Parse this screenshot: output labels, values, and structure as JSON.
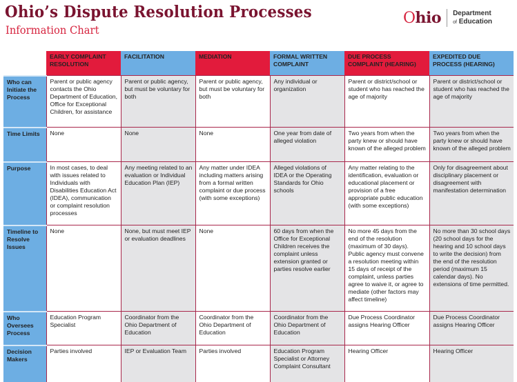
{
  "header": {
    "title": "Ohio’s Dispute Resolution Processes",
    "subtitle": "Information Chart",
    "logo": {
      "brand": "Ohio",
      "brand_first": "O",
      "brand_rest": "hio",
      "dept_line1": "Department",
      "dept_of": "of",
      "dept_line2": "Education"
    }
  },
  "colors": {
    "title": "#7a1430",
    "subtitle": "#d6243f",
    "red_header": "#e21b3c",
    "blue_header": "#6daee3",
    "gray_cell": "#e4e4e6",
    "grid_line": "#a8264a"
  },
  "table": {
    "columns": [
      {
        "label": "EARLY COMPLAINT RESOLUTION",
        "color": "red",
        "shade": "white"
      },
      {
        "label": "FACILITATION",
        "color": "blue",
        "shade": "gray"
      },
      {
        "label": "MEDIATION",
        "color": "red",
        "shade": "white"
      },
      {
        "label": "FORMAL WRITTEN COMPLAINT",
        "color": "blue",
        "shade": "gray"
      },
      {
        "label": "DUE PROCESS COMPLAINT (HEARING)",
        "color": "red",
        "shade": "white"
      },
      {
        "label": "EXPEDITED DUE PROCESS (HEARING)",
        "color": "blue",
        "shade": "gray"
      }
    ],
    "rows": [
      {
        "label": "Who can Initiate the Process",
        "cells": [
          "Parent or public agency contacts the Ohio Department of Education, Office for Exceptional Children, for assistance",
          "Parent or public agency, but must be voluntary for both",
          "Parent or public agency, but must be voluntary for both",
          "Any individual or organization",
          "Parent or district/school or student who has reached the age of majority",
          "Parent or district/school or student who has reached the age of majority"
        ]
      },
      {
        "label": "Time Limits",
        "cells": [
          "None",
          "None",
          "None",
          "One year from date of alleged violation",
          "Two years from when the party knew or should have known of the alleged problem",
          "Two years from when the party knew or should have known of the alleged problem"
        ]
      },
      {
        "label": "Purpose",
        "cells": [
          "In most cases, to deal with issues related to Individuals with Disabilities Education Act (IDEA), communication or complaint resolution processes",
          "Any meeting related to an evaluation or Individual Education Plan (IEP)",
          "Any matter under IDEA including matters arising from a formal written complaint or due process (with some exceptions)",
          "Alleged violations of IDEA or the Operating Standards for Ohio schools",
          "Any matter relating to the identification, evaluation or educational placement or provision of a free appropriate public education (with some exceptions)",
          "Only for disagreement about disciplinary placement or disagreement with manifestation determination"
        ]
      },
      {
        "label": "Timeline to Resolve Issues",
        "cells": [
          "None",
          "None, but must meet IEP or evaluation deadlines",
          "None",
          "60 days from when the Office for Exceptional Children receives the complaint unless extension granted or parties resolve earlier",
          "No more 45 days from the end of the resolution (maximum of 30 days). Public agency must convene a resolution meeting within 15 days of receipt of the complaint, unless parties agree to waive it, or agree to mediate (other factors may affect timeline)",
          "No more than 30 school days (20 school days for the hearing and 10 school days to write the decision) from the end of the resolution period (maximum 15 calendar days). No extensions of time permitted."
        ]
      },
      {
        "label": "Who Oversees Process",
        "cells": [
          "Education Program Specialist",
          "Coordinator from the Ohio Department of Education",
          "Coordinator from the Ohio Department of Education",
          "Coordinator from the Ohio Department of Education",
          "Due Process Coordinator assigns Hearing Officer",
          "Due Process Coordinator assigns Hearing Officer"
        ]
      },
      {
        "label": "Decision Makers",
        "cells": [
          "Parties involved",
          "IEP or Evaluation Team",
          "Parties involved",
          "Education Program Specialist or Attorney Complaint Consultant",
          "Hearing Officer",
          "Hearing Officer"
        ]
      }
    ]
  }
}
